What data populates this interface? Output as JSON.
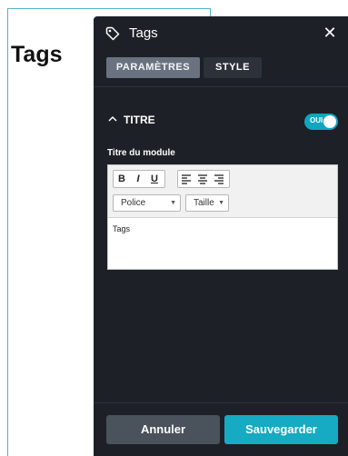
{
  "background": {
    "title": "Tags"
  },
  "panel": {
    "title": "Tags",
    "close_symbol": "✕",
    "icon": "tag-icon",
    "tabs": [
      {
        "label": "PARAMÈTRES",
        "active": true
      },
      {
        "label": "STYLE",
        "active": false
      }
    ],
    "section": {
      "title": "TITRE",
      "toggle_label": "OUI",
      "toggle_on": true
    },
    "field_label": "Titre du module",
    "editor": {
      "bold": "B",
      "italic": "I",
      "underline": "U",
      "font_select": "Police",
      "size_select": "Taille",
      "content": "Tags"
    },
    "footer": {
      "cancel": "Annuler",
      "save": "Sauvegarder"
    }
  },
  "colors": {
    "accent": "#16aac3",
    "panel_bg": "#1d2127",
    "frame_border": "#4fb3c8"
  }
}
